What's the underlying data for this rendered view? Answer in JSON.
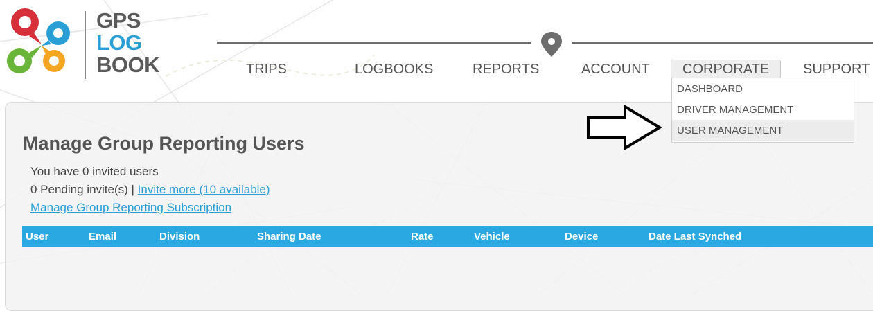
{
  "logo": {
    "line1": "GPS",
    "line2": "LOG",
    "line3": "BOOK",
    "colors": {
      "red": "#d8303a",
      "blue": "#2a9fd6",
      "green": "#6bb43a",
      "orange": "#f4a522"
    }
  },
  "nav": {
    "items": [
      {
        "label": "TRIPS"
      },
      {
        "label": "LOGBOOKS"
      },
      {
        "label": "REPORTS"
      },
      {
        "label": "ACCOUNT"
      },
      {
        "label": "CORPORATE"
      },
      {
        "label": "SUPPORT"
      }
    ],
    "dropdown": [
      {
        "label": "DASHBOARD"
      },
      {
        "label": "DRIVER MANAGEMENT"
      },
      {
        "label": "USER MANAGEMENT"
      }
    ],
    "active_dropdown_item": "USER MANAGEMENT"
  },
  "page": {
    "title": "Manage Group Reporting Users",
    "invited_text": "You have 0 invited users",
    "pending_text": "0 Pending invite(s) | ",
    "invite_more_link": "Invite more (10 available)",
    "manage_subscription_link": "Manage Group Reporting Subscription"
  },
  "table": {
    "columns": [
      "User",
      "Email",
      "Division",
      "Sharing Date",
      "Rate",
      "Vehicle",
      "Device",
      "Date Last Synched"
    ]
  },
  "colors": {
    "accent": "#29a8e1",
    "link": "#2a9fd6",
    "text": "#555555"
  },
  "icons": {
    "map_pin": "map-pin-icon",
    "arrow": "right-arrow-icon"
  }
}
